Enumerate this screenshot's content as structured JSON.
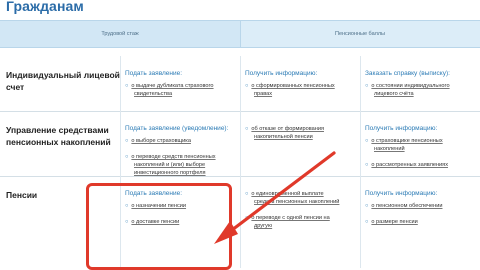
{
  "page": {
    "title": "Гражданам"
  },
  "tabs": [
    {
      "label": "Трудовой стаж"
    },
    {
      "label": "Пенсионные баллы"
    }
  ],
  "rows": [
    {
      "title": "Индивидуальный лицевой счет",
      "title_lines": [
        "Индивидуальный лицевой",
        "счет"
      ],
      "cells": [
        {
          "heading": "Подать заявление:",
          "links": [
            [
              "о выдаче дубликата страхового",
              "свидетельства"
            ]
          ]
        },
        {
          "heading": "Получить информацию:",
          "links": [
            [
              "о сформированных пенсионных",
              "правах"
            ]
          ]
        },
        {
          "heading": "Заказать справку (выписку):",
          "links": [
            [
              "о состоянии индивидуального",
              "лицевого счёта"
            ]
          ]
        }
      ]
    },
    {
      "title": "Управление средствами пенсионных накоплений",
      "title_lines": [
        "Управление средствами",
        "пенсионных накоплений"
      ],
      "cells": [
        {
          "heading": "Подать заявление (уведомление):",
          "links": [
            [
              "о выборе страховщика"
            ],
            [
              "о переводе средств пенсионных",
              "накоплений и (или) выборе",
              "инвестиционного портфеля"
            ]
          ]
        },
        {
          "heading": "",
          "links": [
            [
              "об отказе от формирования",
              "накопительной пенсии"
            ]
          ]
        },
        {
          "heading": "Получить информацию:",
          "links": [
            [
              "о страховщике пенсионных",
              "накоплений"
            ],
            [
              "о рассмотренных заявлениях"
            ]
          ]
        }
      ]
    },
    {
      "title": "Пенсии",
      "title_lines": [
        "Пенсии"
      ],
      "cells": [
        {
          "heading": "Подать заявление:",
          "links": [
            [
              "о назначении пенсии"
            ],
            [
              "о доставке пенсии"
            ]
          ]
        },
        {
          "heading": "",
          "links": [
            [
              "о единовременной выплате",
              "средств пенсионных накоплений"
            ],
            [
              "о переводе с одной пенсии на",
              "другую"
            ]
          ]
        },
        {
          "heading": "Получить информацию:",
          "links": [
            [
              "о пенсионном обеспечении"
            ],
            [
              "о размере пенсии"
            ]
          ]
        }
      ]
    }
  ],
  "colors": {
    "title": "#2b6ca8",
    "link_heading": "#2b7bb5",
    "highlight": "#e0392a",
    "tabs_bg": "#dcedf8"
  },
  "icons": {
    "bullet": "bullet-icon",
    "callout": "arrow-icon"
  }
}
